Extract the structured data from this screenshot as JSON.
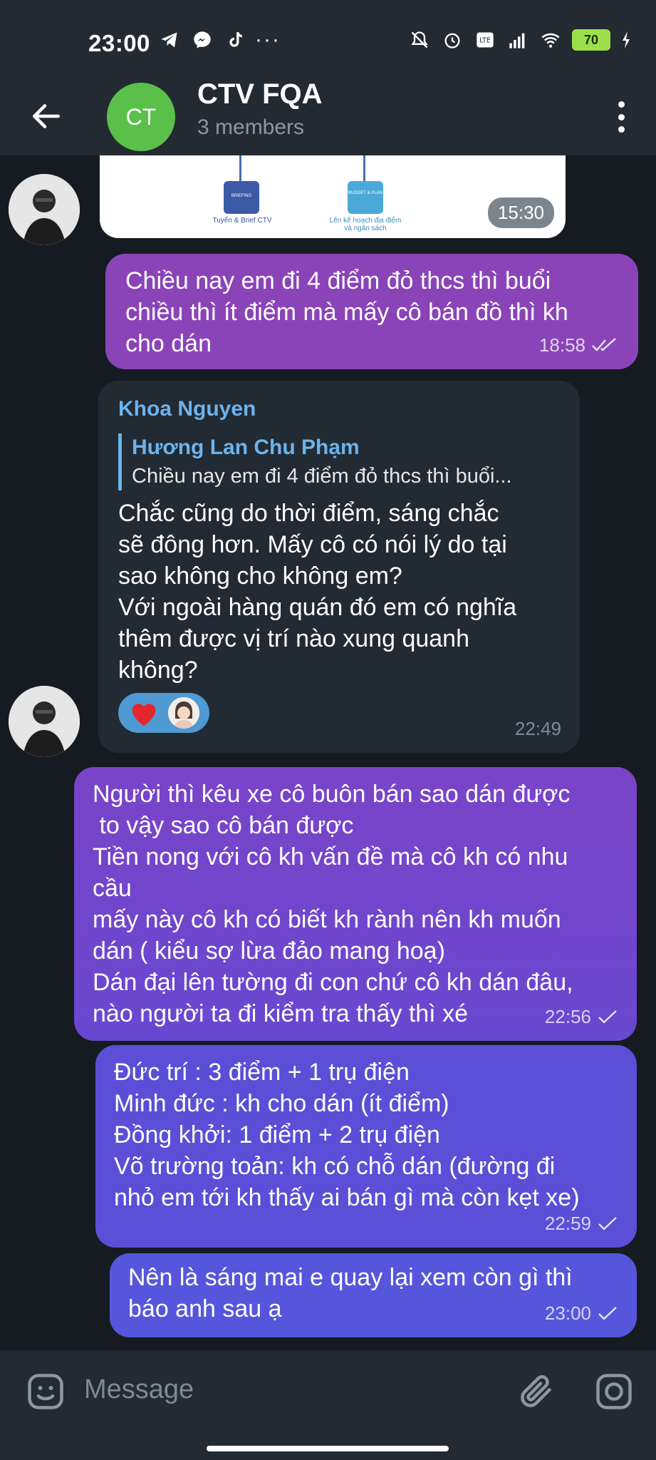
{
  "status_bar": {
    "time": "23:00",
    "left_icons": [
      "telegram-icon",
      "messenger-icon",
      "tiktok-icon",
      "more-dots-icon"
    ],
    "right_icons": [
      "mute-icon",
      "alarm-icon",
      "volte-icon",
      "signal-icon",
      "wifi-icon"
    ],
    "battery": "70"
  },
  "header": {
    "avatar_initials": "CT",
    "title": "CTV FQA",
    "subtitle": "3 members"
  },
  "image_message": {
    "time": "15:30",
    "caption_left": "Tuyển & Brief CTV",
    "caption_right": "Lên kế hoạch địa điểm và ngân sách",
    "chip_left": "BRIEFING",
    "chip_right": "BUDGET & PLAN"
  },
  "messages": [
    {
      "id": "m1",
      "direction": "out",
      "text": "Chiều nay em đi 4 điểm đỏ thcs thì buổi\nchiều thì ít điểm mà mấy cô bán đồ thì kh\ncho dán",
      "time": "18:58",
      "status": "read"
    },
    {
      "id": "m2",
      "direction": "in",
      "sender": "Khoa Nguyen",
      "reply_to": {
        "name": "Hương Lan Chu Phạm",
        "text": "Chiều nay em đi 4 điểm đỏ thcs thì buổi..."
      },
      "text": "Chắc cũng do thời điểm, sáng chắc\nsẽ đông hơn. Mấy cô có nói lý do tại\nsao không cho không em?\nVới ngoài hàng quán đó em có nghĩa\nthêm được vị trí nào xung quanh\nkhông?",
      "reactions": [
        "heart"
      ],
      "time": "22:49"
    },
    {
      "id": "m3",
      "direction": "out",
      "text": "Người thì kêu xe cô buôn bán sao dán được\n to vậy sao cô bán được\nTiền nong với cô kh vấn đề mà cô kh có nhu\ncầu\nmấy này cô kh có biết kh rành nên kh muốn\ndán ( kiểu sợ lừa đảo mang hoạ)\nDán đại lên tường đi con chứ cô kh dán đâu,\nnào người ta đi kiểm tra thấy thì xé",
      "time": "22:56",
      "status": "sent"
    },
    {
      "id": "m4",
      "direction": "out",
      "text": "Đức trí : 3 điểm + 1 trụ điện\nMinh đức : kh cho dán (ít điểm)\nĐồng khởi: 1 điểm + 2 trụ điện\nVõ trường toản: kh có chỗ dán (đường đi\nnhỏ em tới kh thấy ai bán gì mà còn kẹt xe)",
      "time": "22:59",
      "status": "sent"
    },
    {
      "id": "m5",
      "direction": "out",
      "text": "Nên là sáng mai e quay lại xem còn gì thì\nbáo anh sau ạ",
      "time": "23:00",
      "status": "sent"
    }
  ],
  "composer": {
    "placeholder": "Message"
  },
  "colors": {
    "header_bg": "#232a32",
    "chat_bg": "#161b21",
    "incoming_bubble": "#222a33",
    "accent_name": "#6cb3ec",
    "outgoing_purple": "#8a44b8",
    "outgoing_violet": "#5a4fd6"
  }
}
